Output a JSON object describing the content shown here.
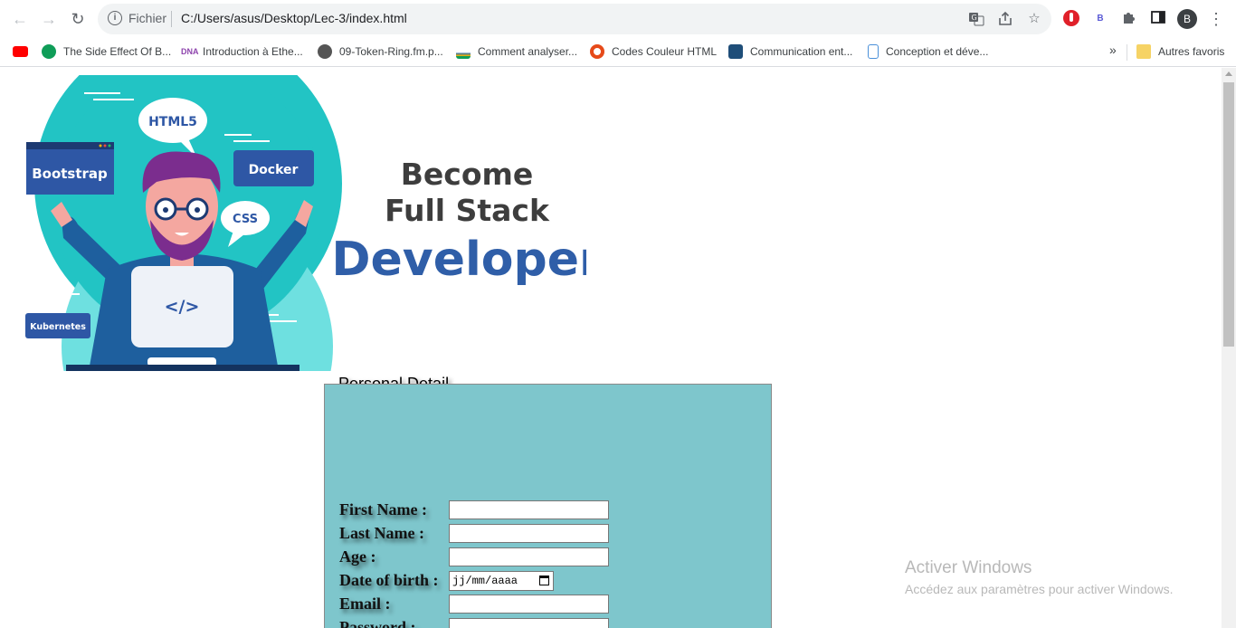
{
  "browser": {
    "url_scheme": "Fichier",
    "url": "C:/Users/asus/Desktop/Lec-3/index.html",
    "profile_initial": "B",
    "extension_b_label": "B"
  },
  "bookmarks": [
    {
      "label": "The Side Effect Of B...",
      "color": "#0f9d58"
    },
    {
      "label": "Introduction à Ethe...",
      "color": "#8e44ad"
    },
    {
      "label": "09-Token-Ring.fm.p...",
      "color": "#444444"
    },
    {
      "label": "Comment analyser...",
      "color": "#2a6fb0"
    },
    {
      "label": "Codes Couleur HTML",
      "color": "#e64a19"
    },
    {
      "label": "Communication ent...",
      "color": "#1f4e79"
    },
    {
      "label": "Conception et déve...",
      "color": "#4a90d9"
    }
  ],
  "bookmarks_other": "Autres favoris",
  "bookmarks_more": "»",
  "banner": {
    "line1": "Become",
    "line2": "Full Stack",
    "line3": "Developer",
    "tags": {
      "html5": "HTML5",
      "bootstrap": "Bootstrap",
      "docker": "Docker",
      "css": "CSS",
      "kubernetes": "Kubernetes",
      "code": "</>"
    }
  },
  "form": {
    "legend": "Personal Detail",
    "fields": [
      {
        "label": "First Name :"
      },
      {
        "label": "Last Name :"
      },
      {
        "label": "Age :"
      },
      {
        "label": "Date of birth :",
        "placeholder": "jj/mm/aaaa"
      },
      {
        "label": "Email :"
      },
      {
        "label": "Password :"
      }
    ]
  },
  "watermark": {
    "title": "Activer Windows",
    "subtitle": "Accédez aux paramètres pour activer Windows."
  }
}
